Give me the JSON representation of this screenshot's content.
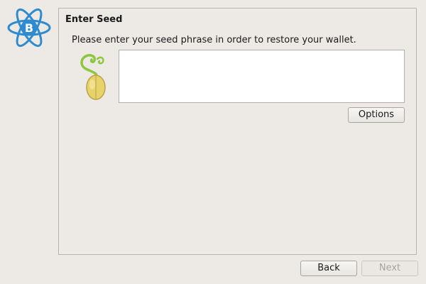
{
  "page": {
    "title": "Enter Seed",
    "instruction": "Please enter your seed phrase in order to restore your wallet."
  },
  "seed_input": {
    "value": "",
    "placeholder": ""
  },
  "buttons": {
    "options": "Options",
    "back": "Back",
    "next": "Next"
  },
  "icons": {
    "logo": "electrum-bitcoin-logo-icon",
    "seed": "seed-sprout-icon"
  },
  "colors": {
    "logo_blue": "#2f8bd0",
    "seed_yellow": "#e8d36a",
    "sprout_green": "#8dc63f"
  }
}
